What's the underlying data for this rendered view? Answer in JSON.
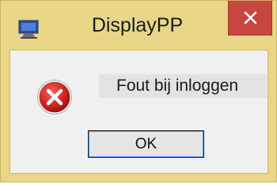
{
  "window": {
    "title": "DisplayPP",
    "app_icon": "monitor-icon",
    "close_icon": "close-icon"
  },
  "dialog": {
    "icon": "error-icon",
    "message": "Fout bij inloggen",
    "ok_label": "OK"
  },
  "colors": {
    "frame": "#e8d689",
    "close_button": "#c64640",
    "client_background": "#f0f0f0",
    "error_red": "#c8201e"
  }
}
